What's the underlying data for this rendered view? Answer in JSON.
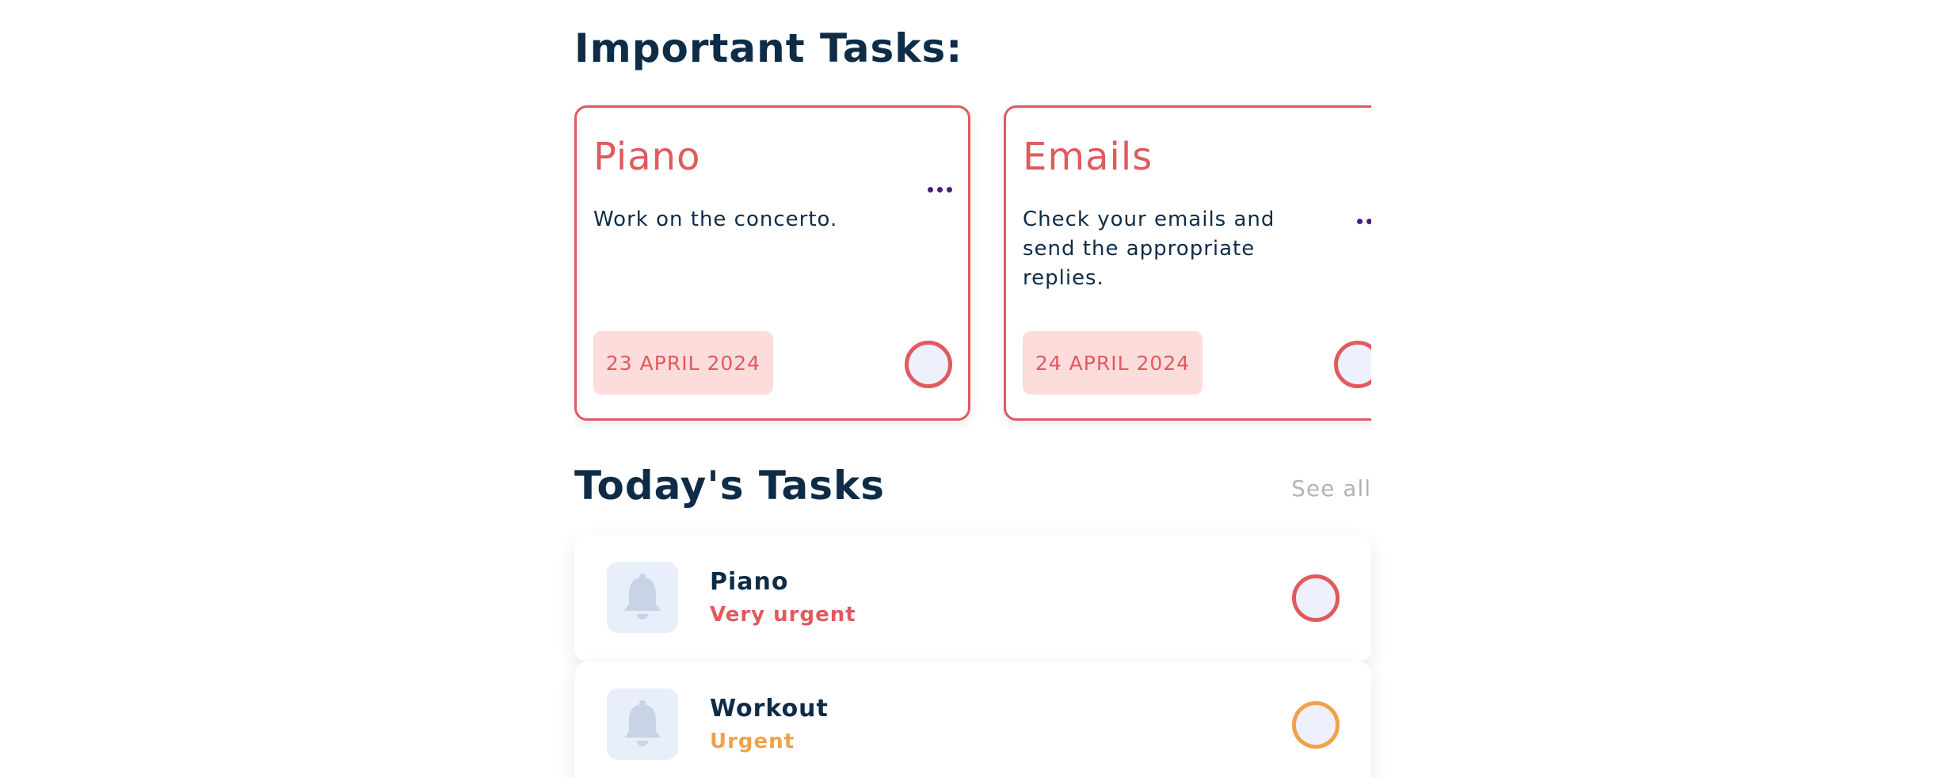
{
  "important": {
    "title": "Important Tasks:",
    "cards": [
      {
        "title": "Piano",
        "description": "Work on the concerto.",
        "date": "23 APRIL 2024"
      },
      {
        "title": "Emails",
        "description": "Check your emails and send the appropriate replies.",
        "date": "24 APRIL 2024"
      }
    ]
  },
  "today": {
    "title": "Today's Tasks",
    "see_all": "See all",
    "tasks": [
      {
        "name": "Piano",
        "priority": "Very urgent",
        "priority_color": "#e05a5f",
        "icon": "bell-icon"
      },
      {
        "name": "Workout",
        "priority": "Urgent",
        "priority_color": "#f0a24a",
        "icon": "bell-icon"
      }
    ]
  },
  "colors": {
    "accent_red": "#e05a5f",
    "accent_orange": "#f0a24a",
    "navy": "#0f2c47",
    "date_bg": "#fddcdc",
    "icon_bg": "#e9eefb"
  }
}
